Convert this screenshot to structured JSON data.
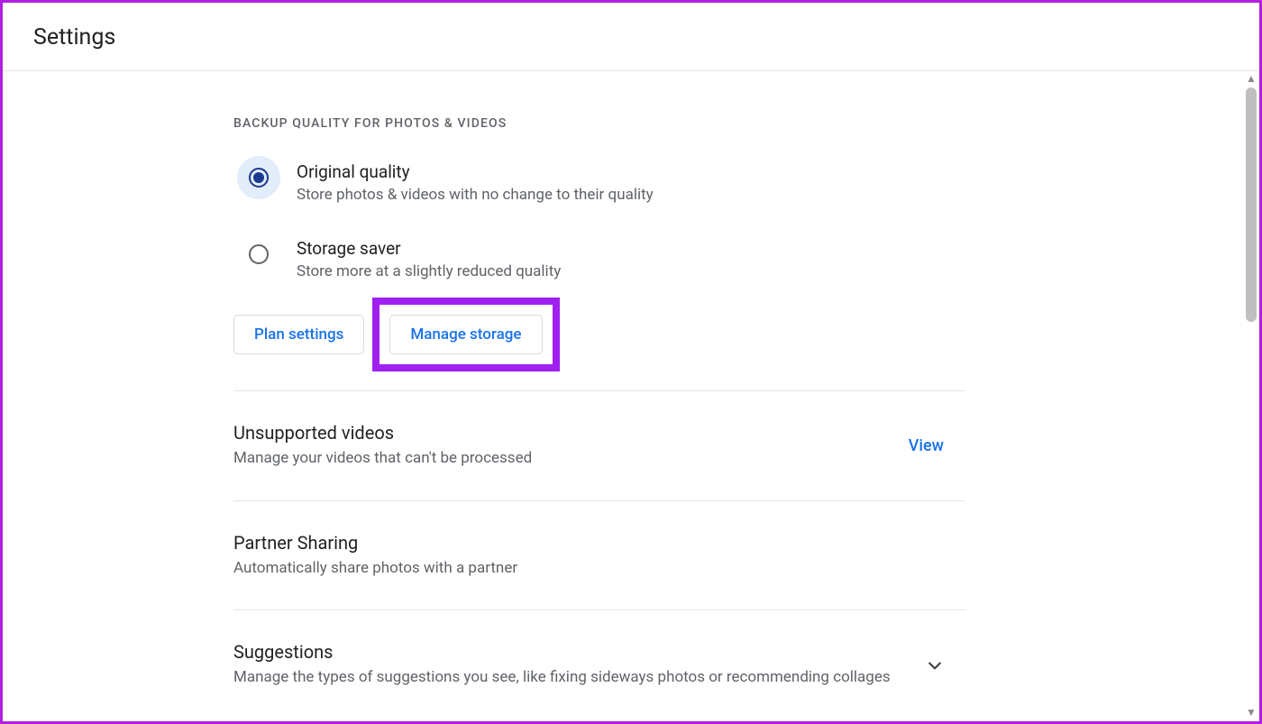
{
  "header": {
    "title": "Settings"
  },
  "backup": {
    "section_label": "BACKUP QUALITY FOR PHOTOS & VIDEOS",
    "options": [
      {
        "title": "Original quality",
        "desc": "Store photos & videos with no change to their quality",
        "selected": true
      },
      {
        "title": "Storage saver",
        "desc": "Store more at a slightly reduced quality",
        "selected": false
      }
    ],
    "plan_settings_label": "Plan settings",
    "manage_storage_label": "Manage storage"
  },
  "unsupported": {
    "title": "Unsupported videos",
    "desc": "Manage your videos that can't be processed",
    "action": "View"
  },
  "partner": {
    "title": "Partner Sharing",
    "desc": "Automatically share photos with a partner"
  },
  "suggestions": {
    "title": "Suggestions",
    "desc": "Manage the types of suggestions you see, like fixing sideways photos or recommending collages"
  }
}
